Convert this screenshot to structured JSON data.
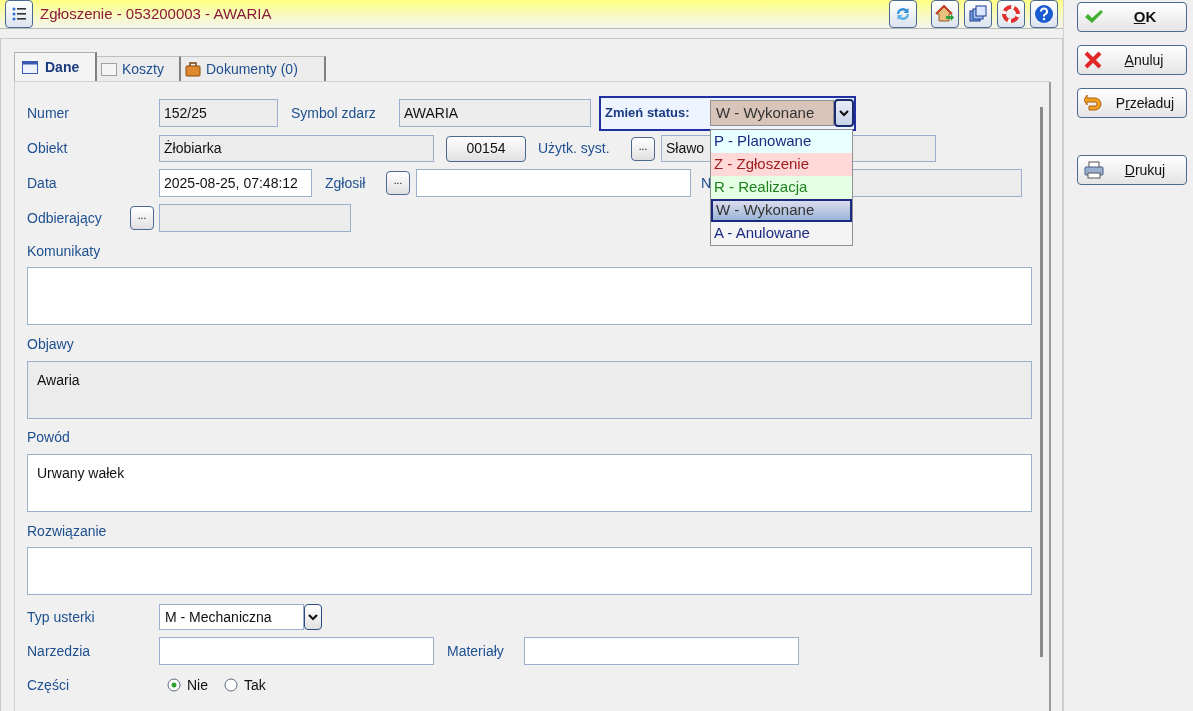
{
  "window": {
    "title": "Zgłoszenie - 053200003 - AWARIA"
  },
  "side_buttons": [
    {
      "parts": [
        {
          "text": "O",
          "underlined": true
        },
        {
          "text": "K",
          "underlined": false
        }
      ],
      "bold": true
    },
    {
      "parts": [
        {
          "text": "A",
          "underlined": true
        },
        {
          "text": "nuluj",
          "underlined": false
        }
      ],
      "bold": false
    },
    {
      "parts": [
        {
          "text": "P",
          "underlined": false
        },
        {
          "text": "r",
          "underlined": true
        },
        {
          "text": "zeładuj",
          "underlined": false
        }
      ],
      "bold": false
    },
    {
      "parts": [
        {
          "text": "D",
          "underlined": true
        },
        {
          "text": "rukuj",
          "underlined": false
        }
      ],
      "bold": false
    }
  ],
  "tabs": [
    {
      "label": "Dane",
      "selected": true
    },
    {
      "label": "Koszty",
      "selected": false
    },
    {
      "label": "Dokumenty (0)",
      "selected": false
    }
  ],
  "form": {
    "numer": {
      "label": "Numer",
      "value": "152/25",
      "readonly": true
    },
    "symbol": {
      "label": "Symbol zdarz",
      "value": "AWARIA",
      "readonly": true
    },
    "status": {
      "label": "Zmień status:",
      "value": "W - Wykonane",
      "expanded": true,
      "options": [
        {
          "label": "P - Planowane",
          "color": "#e8ffff",
          "selected": false
        },
        {
          "label": "Z - Zgłoszenie",
          "color": "#ffd8d8",
          "selected": false
        },
        {
          "label": "R - Realizacja",
          "color": "#e4ffe4",
          "selected": false
        },
        {
          "label": "W - Wykonane",
          "color": "#9ab4d8",
          "selected": true
        },
        {
          "label": "A - Anulowane",
          "color": "#f4f4f4",
          "selected": false
        }
      ]
    },
    "obiekt": {
      "label": "Obiekt",
      "value": "Żłobiarka",
      "readonly": true,
      "code_button": "00154"
    },
    "uzytk": {
      "label": "Użytk. syst.",
      "button": "...",
      "value": "Sławo",
      "readonly": true
    },
    "data": {
      "label": "Data",
      "value": "2025-08-25, 07:48:12",
      "readonly": false
    },
    "zglosil": {
      "label": "Zgłosił",
      "button": "...",
      "readonly": false
    },
    "field_n": {
      "label": "N",
      "readonly": true
    },
    "odbierajacy": {
      "label": "Odbierający",
      "button": "...",
      "readonly": true
    },
    "komunikaty": {
      "label": "Komunikaty",
      "readonly": false
    },
    "objawy": {
      "label": "Objawy",
      "value": "Awaria",
      "readonly": true
    },
    "powod": {
      "label": "Powód",
      "value": "Urwany wałek",
      "readonly": false
    },
    "rozwiazanie": {
      "label": "Rozwiązanie",
      "readonly": false
    },
    "typ_usterki": {
      "label": "Typ usterki",
      "value": "M - Mechaniczna"
    },
    "narzedzia": {
      "label": "Narzedzia",
      "readonly": false
    },
    "materialy": {
      "label": "Materiały",
      "readonly": false
    },
    "czesci": {
      "label": "Części",
      "options": [
        {
          "label": "Nie",
          "selected": true
        },
        {
          "label": "Tak",
          "selected": false
        }
      ]
    }
  }
}
